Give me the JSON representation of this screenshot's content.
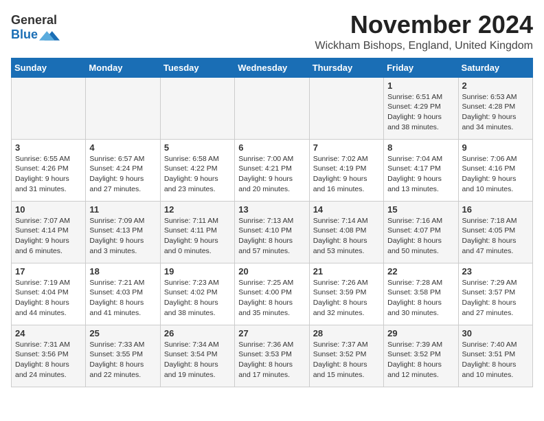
{
  "logo": {
    "general": "General",
    "blue": "Blue"
  },
  "title": "November 2024",
  "location": "Wickham Bishops, England, United Kingdom",
  "days_of_week": [
    "Sunday",
    "Monday",
    "Tuesday",
    "Wednesday",
    "Thursday",
    "Friday",
    "Saturday"
  ],
  "weeks": [
    [
      {
        "day": "",
        "info": ""
      },
      {
        "day": "",
        "info": ""
      },
      {
        "day": "",
        "info": ""
      },
      {
        "day": "",
        "info": ""
      },
      {
        "day": "",
        "info": ""
      },
      {
        "day": "1",
        "info": "Sunrise: 6:51 AM\nSunset: 4:29 PM\nDaylight: 9 hours\nand 38 minutes."
      },
      {
        "day": "2",
        "info": "Sunrise: 6:53 AM\nSunset: 4:28 PM\nDaylight: 9 hours\nand 34 minutes."
      }
    ],
    [
      {
        "day": "3",
        "info": "Sunrise: 6:55 AM\nSunset: 4:26 PM\nDaylight: 9 hours\nand 31 minutes."
      },
      {
        "day": "4",
        "info": "Sunrise: 6:57 AM\nSunset: 4:24 PM\nDaylight: 9 hours\nand 27 minutes."
      },
      {
        "day": "5",
        "info": "Sunrise: 6:58 AM\nSunset: 4:22 PM\nDaylight: 9 hours\nand 23 minutes."
      },
      {
        "day": "6",
        "info": "Sunrise: 7:00 AM\nSunset: 4:21 PM\nDaylight: 9 hours\nand 20 minutes."
      },
      {
        "day": "7",
        "info": "Sunrise: 7:02 AM\nSunset: 4:19 PM\nDaylight: 9 hours\nand 16 minutes."
      },
      {
        "day": "8",
        "info": "Sunrise: 7:04 AM\nSunset: 4:17 PM\nDaylight: 9 hours\nand 13 minutes."
      },
      {
        "day": "9",
        "info": "Sunrise: 7:06 AM\nSunset: 4:16 PM\nDaylight: 9 hours\nand 10 minutes."
      }
    ],
    [
      {
        "day": "10",
        "info": "Sunrise: 7:07 AM\nSunset: 4:14 PM\nDaylight: 9 hours\nand 6 minutes."
      },
      {
        "day": "11",
        "info": "Sunrise: 7:09 AM\nSunset: 4:13 PM\nDaylight: 9 hours\nand 3 minutes."
      },
      {
        "day": "12",
        "info": "Sunrise: 7:11 AM\nSunset: 4:11 PM\nDaylight: 9 hours\nand 0 minutes."
      },
      {
        "day": "13",
        "info": "Sunrise: 7:13 AM\nSunset: 4:10 PM\nDaylight: 8 hours\nand 57 minutes."
      },
      {
        "day": "14",
        "info": "Sunrise: 7:14 AM\nSunset: 4:08 PM\nDaylight: 8 hours\nand 53 minutes."
      },
      {
        "day": "15",
        "info": "Sunrise: 7:16 AM\nSunset: 4:07 PM\nDaylight: 8 hours\nand 50 minutes."
      },
      {
        "day": "16",
        "info": "Sunrise: 7:18 AM\nSunset: 4:05 PM\nDaylight: 8 hours\nand 47 minutes."
      }
    ],
    [
      {
        "day": "17",
        "info": "Sunrise: 7:19 AM\nSunset: 4:04 PM\nDaylight: 8 hours\nand 44 minutes."
      },
      {
        "day": "18",
        "info": "Sunrise: 7:21 AM\nSunset: 4:03 PM\nDaylight: 8 hours\nand 41 minutes."
      },
      {
        "day": "19",
        "info": "Sunrise: 7:23 AM\nSunset: 4:02 PM\nDaylight: 8 hours\nand 38 minutes."
      },
      {
        "day": "20",
        "info": "Sunrise: 7:25 AM\nSunset: 4:00 PM\nDaylight: 8 hours\nand 35 minutes."
      },
      {
        "day": "21",
        "info": "Sunrise: 7:26 AM\nSunset: 3:59 PM\nDaylight: 8 hours\nand 32 minutes."
      },
      {
        "day": "22",
        "info": "Sunrise: 7:28 AM\nSunset: 3:58 PM\nDaylight: 8 hours\nand 30 minutes."
      },
      {
        "day": "23",
        "info": "Sunrise: 7:29 AM\nSunset: 3:57 PM\nDaylight: 8 hours\nand 27 minutes."
      }
    ],
    [
      {
        "day": "24",
        "info": "Sunrise: 7:31 AM\nSunset: 3:56 PM\nDaylight: 8 hours\nand 24 minutes."
      },
      {
        "day": "25",
        "info": "Sunrise: 7:33 AM\nSunset: 3:55 PM\nDaylight: 8 hours\nand 22 minutes."
      },
      {
        "day": "26",
        "info": "Sunrise: 7:34 AM\nSunset: 3:54 PM\nDaylight: 8 hours\nand 19 minutes."
      },
      {
        "day": "27",
        "info": "Sunrise: 7:36 AM\nSunset: 3:53 PM\nDaylight: 8 hours\nand 17 minutes."
      },
      {
        "day": "28",
        "info": "Sunrise: 7:37 AM\nSunset: 3:52 PM\nDaylight: 8 hours\nand 15 minutes."
      },
      {
        "day": "29",
        "info": "Sunrise: 7:39 AM\nSunset: 3:52 PM\nDaylight: 8 hours\nand 12 minutes."
      },
      {
        "day": "30",
        "info": "Sunrise: 7:40 AM\nSunset: 3:51 PM\nDaylight: 8 hours\nand 10 minutes."
      }
    ]
  ]
}
